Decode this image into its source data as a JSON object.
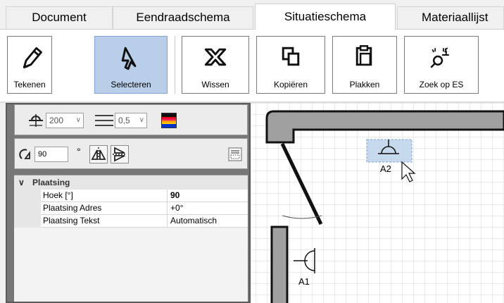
{
  "tabs": [
    {
      "label": "Document"
    },
    {
      "label": "Eendraadschema"
    },
    {
      "label": "Situatieschema"
    },
    {
      "label": "Materiaallijst"
    }
  ],
  "active_tab": "Situatieschema",
  "ribbon": {
    "buttons": [
      {
        "label": "Tekenen",
        "icon": "pencil-icon"
      },
      {
        "label": "Selecteren",
        "icon": "cursor-icon",
        "active": true
      },
      {
        "label": "Wissen",
        "icon": "erase-x-icon"
      },
      {
        "label": "Kopiëren",
        "icon": "copy-icon"
      },
      {
        "label": "Plakken",
        "icon": "paste-icon"
      },
      {
        "label": "Zoek op ES",
        "icon": "search-es-icon"
      }
    ]
  },
  "toolbar": {
    "size_value": "200",
    "line_width_value": "0,5",
    "rotation_value": "90",
    "degree_symbol": "°"
  },
  "properties": {
    "category": "Plaatsing",
    "rows": [
      {
        "name": "Hoek [°]",
        "value": "90",
        "bold": true
      },
      {
        "name": "Plaatsing Adres",
        "value": "+0°"
      },
      {
        "name": "Plaatsing Tekst",
        "value": "Automatisch"
      }
    ]
  },
  "canvas": {
    "labels": [
      "A2",
      "A1"
    ]
  },
  "colors": {
    "selection": "#b9cfe9",
    "grid": "#d6d6d6",
    "wall": "#a0a0a0"
  }
}
